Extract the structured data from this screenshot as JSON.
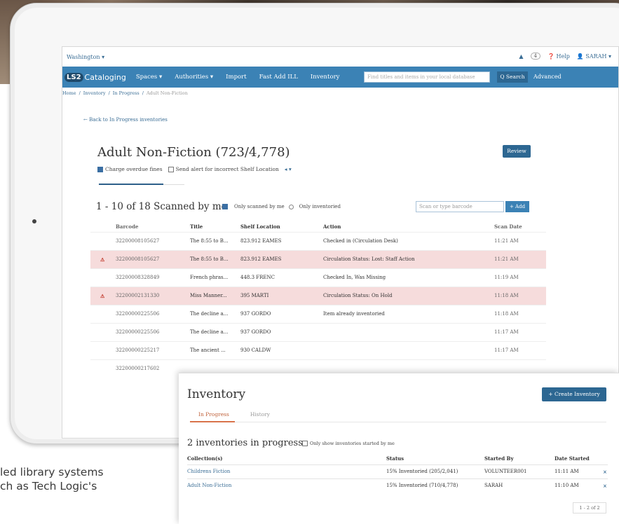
{
  "promo_text": [
    "led library systems",
    "ch as Tech Logic's",
    "..."
  ],
  "util": {
    "location": "Washington ▾",
    "alerts_icon": "bell-icon",
    "alerts_count": "4",
    "help": "Help",
    "user": "SARAH ▾"
  },
  "nav": {
    "logo_mark": "LS2",
    "logo_text": "Cataloging",
    "items": [
      "Spaces ▾",
      "Authorities ▾",
      "Import",
      "Fast Add ILL",
      "Inventory"
    ],
    "search_placeholder": "Find titles and items in your local database",
    "search_button": "Q Search",
    "advanced": "Advanced"
  },
  "breadcrumb": [
    "Home",
    "Inventory",
    "In Progress",
    "Adult Non-Fiction"
  ],
  "back_link": "← Back to In Progress inventories",
  "inventory": {
    "title": "Adult Non-Fiction (723/4,778)",
    "review_button": "Review",
    "option_overdue": "Charge overdue fines",
    "option_alert": "Send alert for incorrect Shelf Location",
    "option_arrows": "◂ ▾"
  },
  "scans": {
    "heading": "1 - 10 of 18 Scanned by me",
    "filter_scanned": "Only scanned by me",
    "filter_inventoried": "Only inventoried",
    "scan_placeholder": "Scan or type barcode",
    "add_button": "+ Add",
    "columns": [
      "Barcode",
      "Title",
      "Shelf Location",
      "Action",
      "Scan Date"
    ],
    "rows": [
      {
        "alert": "",
        "barcode": "32200008105627",
        "title": "The 8:55 to B...",
        "location": "823.912 EAMES",
        "action": "Checked in (Circulation Desk)",
        "date": "11:21 AM",
        "class": "row"
      },
      {
        "alert": "⚠",
        "barcode": "32200008105627",
        "title": "The 8:55 to B...",
        "location": "823.912 EAMES",
        "action": "Circulation Status: Lost: Staff Action",
        "date": "11:21 AM",
        "class": "row alert"
      },
      {
        "alert": "",
        "barcode": "32200008328849",
        "title": "French phras...",
        "location": "448.3 FRENC",
        "action": "Checked In, Was Missing",
        "date": "11:19 AM",
        "class": "row"
      },
      {
        "alert": "⚠",
        "barcode": "32200002131330",
        "title": "Miss Manner...",
        "location": "395 MARTI",
        "action": "Circulation Status: On Hold",
        "date": "11:18 AM",
        "class": "row alert"
      },
      {
        "alert": "",
        "barcode": "32200000225506",
        "title": "The decline a...",
        "location": "937 GORDO",
        "action": "Item already inventoried",
        "date": "11:18 AM",
        "class": "row"
      },
      {
        "alert": "",
        "barcode": "32200000225506",
        "title": "The decline a...",
        "location": "937 GORDO",
        "action": "",
        "date": "11:17 AM",
        "class": "row"
      },
      {
        "alert": "",
        "barcode": "32200000225217",
        "title": "The ancient ...",
        "location": "930 CALDW",
        "action": "",
        "date": "11:17 AM",
        "class": "row"
      },
      {
        "alert": "",
        "barcode": "32200000217602",
        "title": "",
        "location": "",
        "action": "",
        "date": "",
        "class": "row"
      }
    ]
  },
  "panel": {
    "title": "Inventory",
    "create_button": "+ Create Inventory",
    "tabs": [
      "In Progress",
      "History"
    ],
    "subtitle": "2 inventories in progress",
    "filter": "Only show inventories started by me",
    "columns": [
      "Collection(s)",
      "Status",
      "Started By",
      "Date Started"
    ],
    "rows": [
      {
        "collection": "Childrens Fiction",
        "status": "15% Inventoried (205/2,041)",
        "by": "VOLUNTEER001",
        "date": "11:11 AM",
        "remove": "×"
      },
      {
        "collection": "Adult Non-Fiction",
        "status": "15% Inventoried (710/4,778)",
        "by": "SARAH",
        "date": "11:10 AM",
        "remove": "×"
      }
    ],
    "pager": "1 - 2 of 2"
  }
}
